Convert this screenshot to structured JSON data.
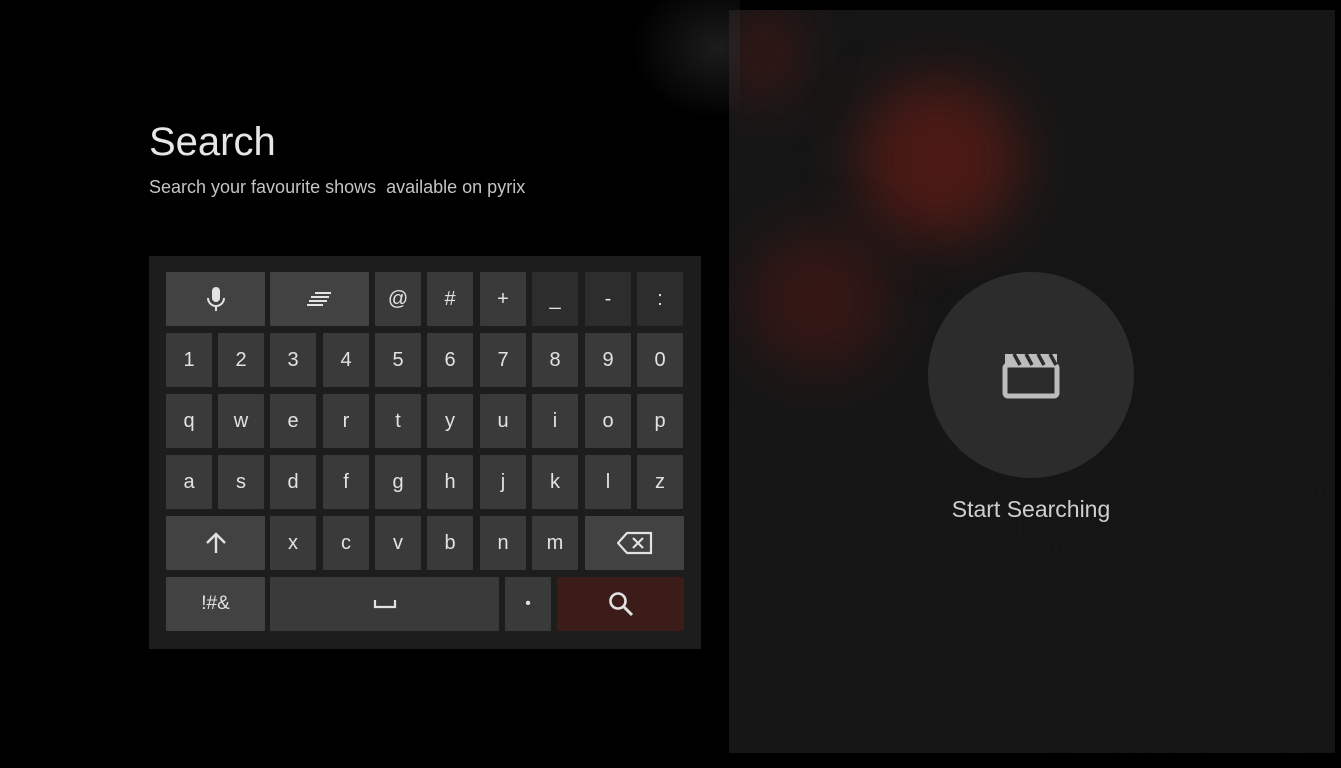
{
  "header": {
    "title": "Search",
    "subtitle": "Search your favourite shows  available on pyrix"
  },
  "keyboard": {
    "row1": {
      "mic_icon": "microphone-icon",
      "language_icon": "text-lines-icon",
      "keys": [
        "@",
        "#",
        "+",
        "_",
        "-",
        ":"
      ]
    },
    "row2": [
      "1",
      "2",
      "3",
      "4",
      "5",
      "6",
      "7",
      "8",
      "9",
      "0"
    ],
    "row3": [
      "q",
      "w",
      "e",
      "r",
      "t",
      "y",
      "u",
      "i",
      "o",
      "p"
    ],
    "row4": [
      "a",
      "s",
      "d",
      "f",
      "g",
      "h",
      "j",
      "k",
      "l",
      "z"
    ],
    "row5": {
      "shift_icon": "arrow-up-icon",
      "keys": [
        "x",
        "c",
        "v",
        "b",
        "n",
        "m"
      ],
      "backspace_icon": "backspace-icon"
    },
    "row6": {
      "symbols_label": "!#&",
      "space_icon": "space-bar-icon",
      "dot_label": "•",
      "search_icon": "search-icon"
    }
  },
  "preview": {
    "icon": "clapperboard-icon",
    "message": "Start Searching"
  },
  "colors": {
    "background": "#000000",
    "keyboard_bg": "#1d1d1d",
    "key_bg": "#3a3a3a",
    "search_key_bg": "#3c1c18",
    "preview_circle": "#2c2c2c"
  }
}
